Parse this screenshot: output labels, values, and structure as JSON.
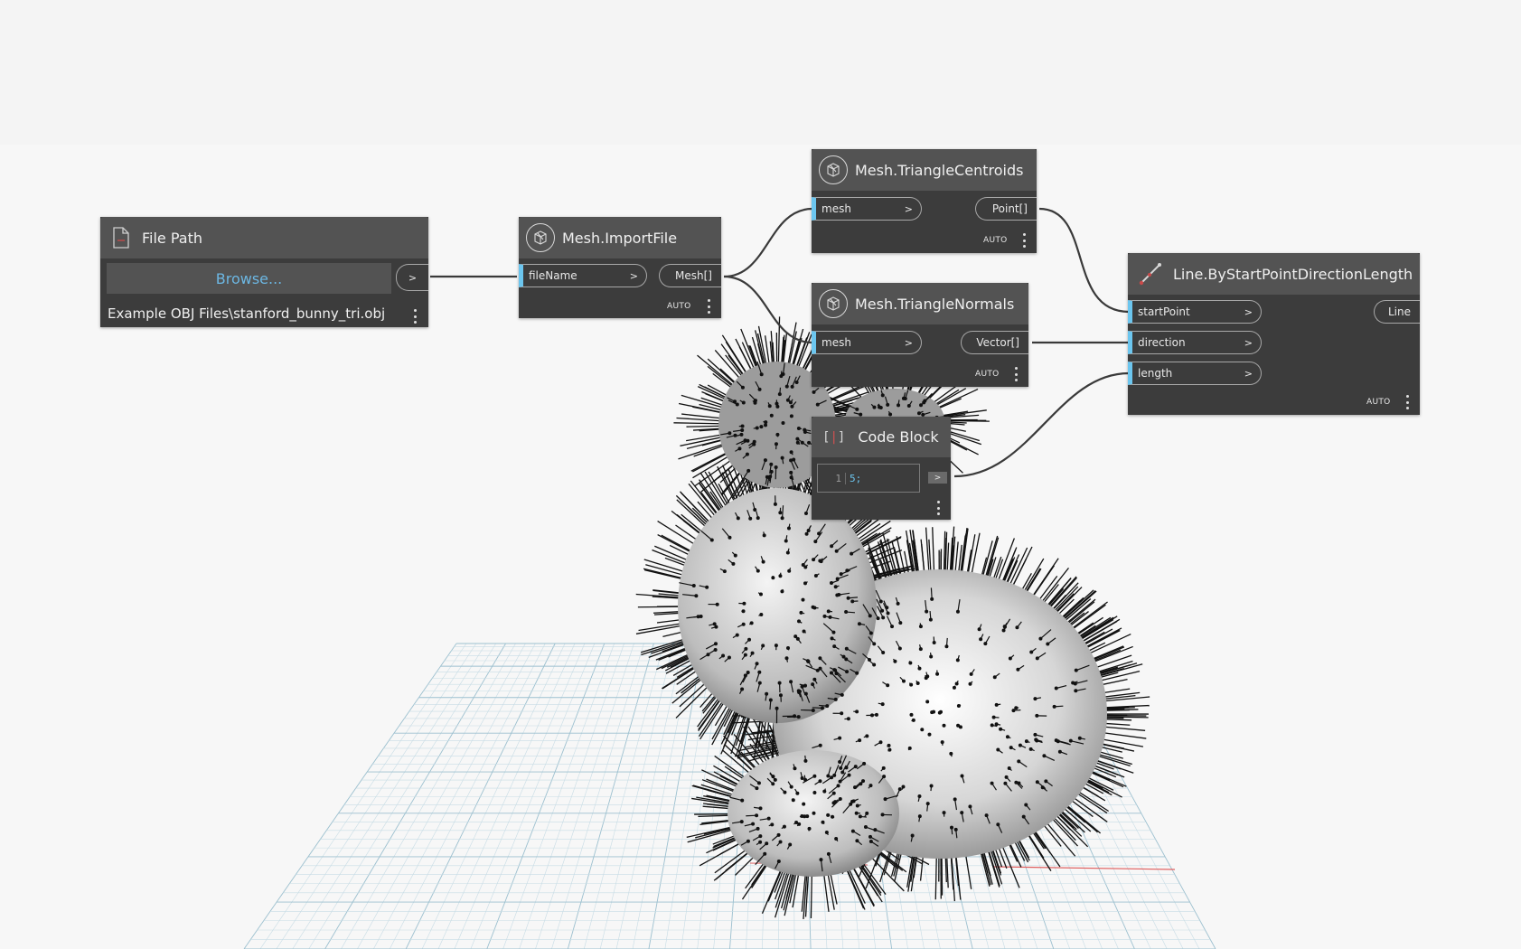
{
  "nodes": {
    "file_path": {
      "title": "File Path",
      "browse_label": "Browse...",
      "output_arrow": ">",
      "path_value": "Example OBJ Files\\stanford_bunny_tri.obj"
    },
    "import_file": {
      "title": "Mesh.ImportFile",
      "input_name": "fileName",
      "input_arrow": ">",
      "output_name": "Mesh[]",
      "lacing": "AUTO"
    },
    "centroids": {
      "title": "Mesh.TriangleCentroids",
      "input_name": "mesh",
      "input_arrow": ">",
      "output_name": "Point[]",
      "lacing": "AUTO"
    },
    "normals": {
      "title": "Mesh.TriangleNormals",
      "input_name": "mesh",
      "input_arrow": ">",
      "output_name": "Vector[]",
      "lacing": "AUTO"
    },
    "code_block": {
      "title": "Code Block",
      "line_number": "1",
      "code": "5;",
      "output_arrow": ">"
    },
    "line_node": {
      "title": "Line.ByStartPointDirectionLength",
      "input1": "startPoint",
      "input2": "direction",
      "input3": "length",
      "input_arrow": ">",
      "output_name": "Line",
      "lacing": "AUTO"
    }
  },
  "colors": {
    "canvas": "#f7f7f7",
    "node_body": "#3c3c3c",
    "node_header": "#535353",
    "input_accent": "#6cc6ef",
    "browse_text": "#6cb7e3",
    "wire": "#3a3a3a",
    "grid": "#a9cbd8",
    "axis_red": "#e06060"
  },
  "icons": {
    "file_path": "file-icon",
    "mesh": "mesh-icon",
    "code_block": "code-block-icon",
    "line": "line-icon"
  }
}
